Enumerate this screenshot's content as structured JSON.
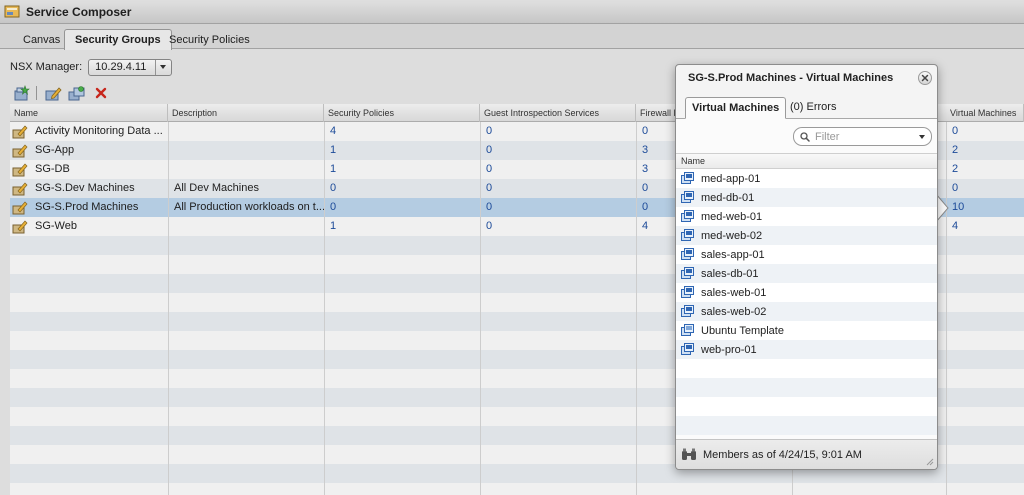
{
  "window": {
    "title": "Service Composer"
  },
  "tabs": [
    {
      "label": "Canvas",
      "active": false
    },
    {
      "label": "Security Groups",
      "active": true
    },
    {
      "label": "Security Policies",
      "active": false
    }
  ],
  "nsx_manager": {
    "label": "NSX Manager:",
    "value": "10.29.4.11"
  },
  "toolbar": {
    "buttons": [
      "new-security-group-icon",
      "edit-security-group-icon",
      "copy-security-group-icon",
      "delete-icon"
    ]
  },
  "grid": {
    "columns": [
      "Name",
      "Description",
      "Security Policies",
      "Guest Introspection Services",
      "Firewall R",
      "Virtual Machines"
    ],
    "rows": [
      {
        "name": "Activity Monitoring Data ...",
        "description": "",
        "policies": "4",
        "guest": "0",
        "firewall": "0",
        "vms": "0",
        "selected": false
      },
      {
        "name": "SG-App",
        "description": "",
        "policies": "1",
        "guest": "0",
        "firewall": "3",
        "vms": "2",
        "selected": false
      },
      {
        "name": "SG-DB",
        "description": "",
        "policies": "1",
        "guest": "0",
        "firewall": "3",
        "vms": "2",
        "selected": false
      },
      {
        "name": "SG-S.Dev Machines",
        "description": "All Dev Machines",
        "policies": "0",
        "guest": "0",
        "firewall": "0",
        "vms": "0",
        "selected": false
      },
      {
        "name": "SG-S.Prod Machines",
        "description": "All Production workloads on t...",
        "policies": "0",
        "guest": "0",
        "firewall": "0",
        "vms": "10",
        "selected": true
      },
      {
        "name": "SG-Web",
        "description": "",
        "policies": "1",
        "guest": "0",
        "firewall": "4",
        "vms": "4",
        "selected": false
      }
    ]
  },
  "popup": {
    "title": "SG-S.Prod Machines - Virtual Machines",
    "tab_vms": "Virtual Machines",
    "tab_errors": "(0) Errors",
    "filter_placeholder": "Filter",
    "list_header": "Name",
    "vms": [
      "med-app-01",
      "med-db-01",
      "med-web-01",
      "med-web-02",
      "sales-app-01",
      "sales-db-01",
      "sales-web-01",
      "sales-web-02",
      "Ubuntu Template",
      "web-pro-01"
    ],
    "footer": "Members as of 4/24/15, 9:01 AM"
  },
  "colors": {
    "link_number": "#1f4fa0",
    "selected_row": "#bcd5ec",
    "delete_red": "#d0281e"
  }
}
